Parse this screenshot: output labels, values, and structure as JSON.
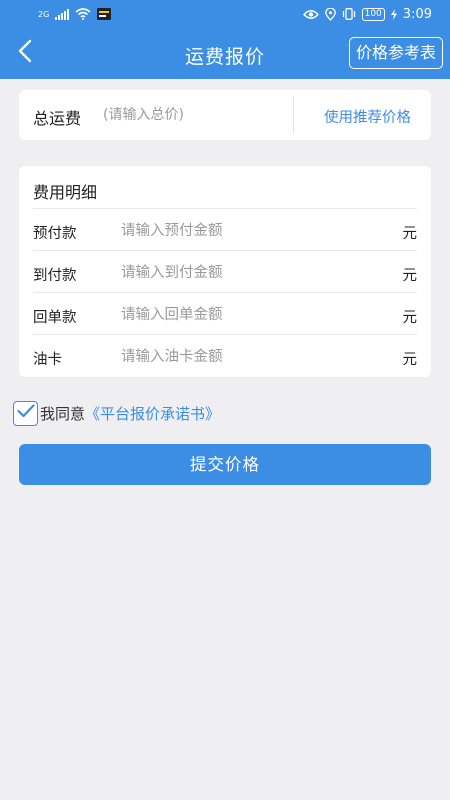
{
  "status_bar": {
    "network": "2G",
    "battery": "100",
    "time": "3:09"
  },
  "header": {
    "title": "运费报价",
    "reference_button": "价格参考表"
  },
  "total": {
    "label": "总运费",
    "placeholder": "(请输入总价)",
    "recommend_link": "使用推荐价格"
  },
  "details": {
    "title": "费用明细",
    "rows": [
      {
        "label": "预付款",
        "placeholder": "请输入预付金额",
        "unit": "元"
      },
      {
        "label": "到付款",
        "placeholder": "请输入到付金额",
        "unit": "元"
      },
      {
        "label": "回单款",
        "placeholder": "请输入回单金额",
        "unit": "元"
      },
      {
        "label": "油卡",
        "placeholder": "请输入油卡金额",
        "unit": "元"
      }
    ]
  },
  "agreement": {
    "prefix": "我同意",
    "link": "《平台报价承诺书》",
    "checked": true
  },
  "submit_label": "提交价格",
  "colors": {
    "primary": "#3c8ee4",
    "background": "#efeef1"
  }
}
